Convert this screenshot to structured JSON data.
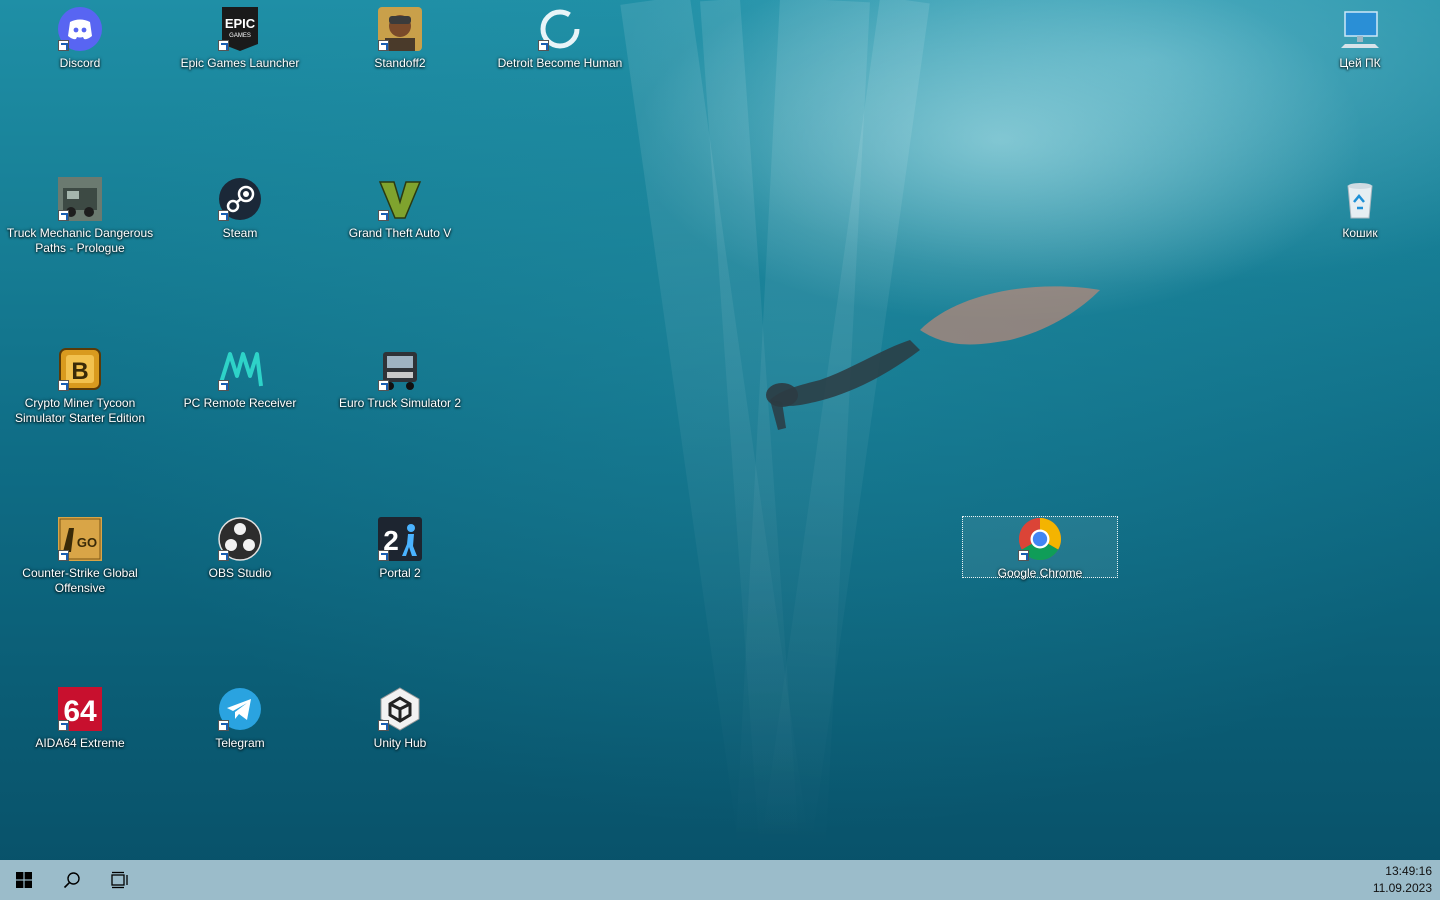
{
  "desktop": {
    "icons": [
      {
        "label": "Discord",
        "icon": "discord-icon"
      },
      {
        "label": "Epic Games Launcher",
        "icon": "epic-games-icon"
      },
      {
        "label": "Standoff2",
        "icon": "standoff2-icon"
      },
      {
        "label": "Detroit Become Human",
        "icon": "detroit-icon"
      },
      {
        "label": "Цей ПК",
        "icon": "this-pc-icon"
      },
      {
        "label": "Truck Mechanic Dangerous Paths - Prologue",
        "icon": "truck-mechanic-icon"
      },
      {
        "label": "Steam",
        "icon": "steam-icon"
      },
      {
        "label": "Grand Theft Auto V",
        "icon": "gta-v-icon"
      },
      {
        "label": "Кошик",
        "icon": "recycle-bin-icon"
      },
      {
        "label": "Crypto Miner Tycoon Simulator Starter Edition",
        "icon": "crypto-miner-icon"
      },
      {
        "label": "PC Remote Receiver",
        "icon": "pc-remote-icon"
      },
      {
        "label": "Euro Truck Simulator 2",
        "icon": "euro-truck-icon"
      },
      {
        "label": "Counter-Strike Global Offensive",
        "icon": "csgo-icon"
      },
      {
        "label": "OBS Studio",
        "icon": "obs-icon"
      },
      {
        "label": "Portal 2",
        "icon": "portal2-icon"
      },
      {
        "label": "Google Chrome",
        "icon": "chrome-icon"
      },
      {
        "label": "AIDA64 Extreme",
        "icon": "aida64-icon"
      },
      {
        "label": "Telegram",
        "icon": "telegram-icon"
      },
      {
        "label": "Unity Hub",
        "icon": "unity-hub-icon"
      }
    ],
    "selected": "Google Chrome"
  },
  "taskbar": {
    "start": "windows-logo-icon",
    "search": "search-icon",
    "task_view": "task-view-icon",
    "clock": {
      "time": "13:49:16",
      "date": "11.09.2023"
    }
  },
  "colors": {
    "taskbar": "#a8c6d2",
    "water": "#177f96"
  }
}
